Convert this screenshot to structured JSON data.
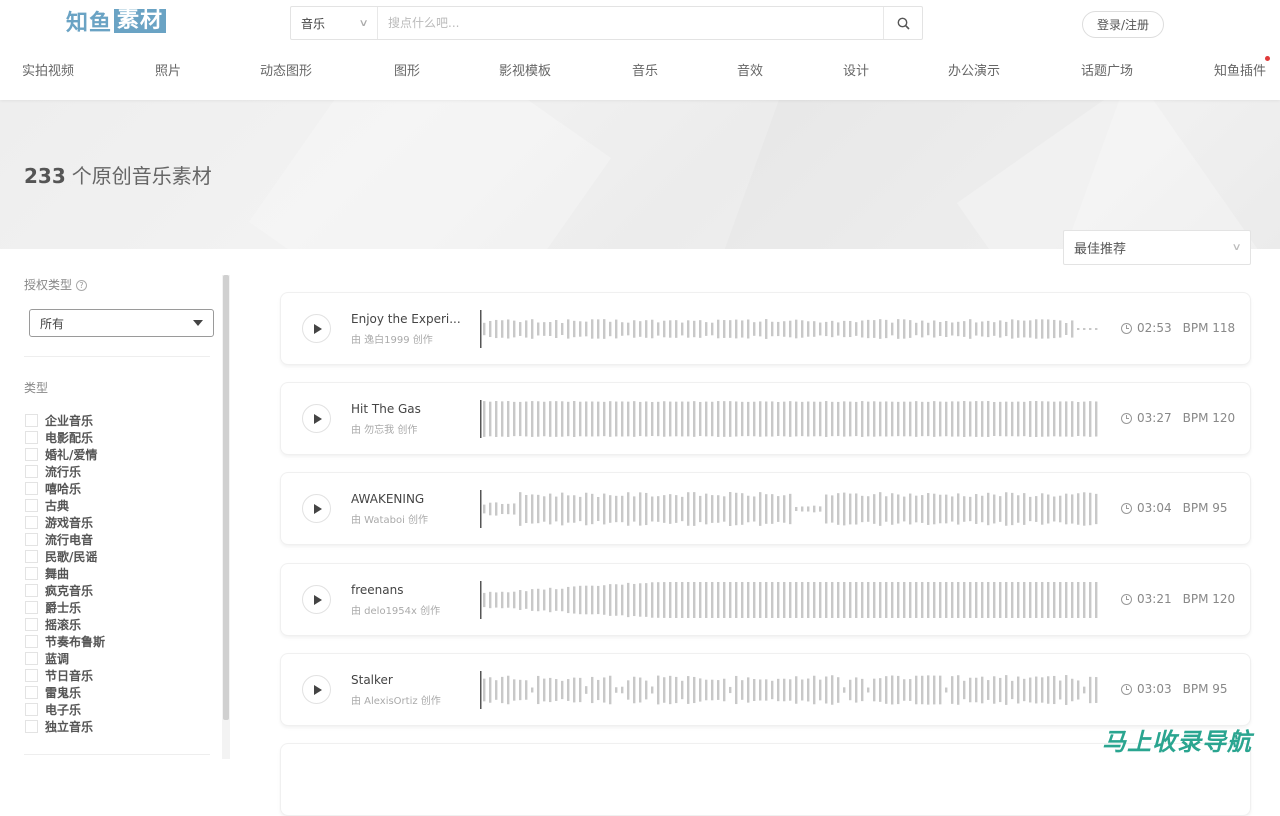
{
  "header": {
    "logo": {
      "part1": "知鱼",
      "part2": "素材"
    },
    "search": {
      "category": "音乐",
      "placeholder": "搜点什么吧..."
    },
    "login_label": "登录/注册",
    "nav": [
      {
        "label": "实拍视频"
      },
      {
        "label": "照片"
      },
      {
        "label": "动态图形"
      },
      {
        "label": "图形"
      },
      {
        "label": "影视模板"
      },
      {
        "label": "音乐"
      },
      {
        "label": "音效"
      },
      {
        "label": "设计"
      },
      {
        "label": "办公演示"
      },
      {
        "label": "话题广场"
      },
      {
        "label": "知鱼插件",
        "badge": "red-dot"
      }
    ]
  },
  "banner": {
    "count": "233",
    "title": "个原创音乐素材"
  },
  "sort": {
    "selected": "最佳推荐"
  },
  "sidebar": {
    "license_label": "授权类型",
    "license_selected": "所有",
    "genre_label": "类型",
    "genres": [
      "企业音乐",
      "电影配乐",
      "婚礼/爱情",
      "流行乐",
      "嘻哈乐",
      "古典",
      "游戏音乐",
      "流行电音",
      "民歌/民谣",
      "舞曲",
      "疯克音乐",
      "爵士乐",
      "摇滚乐",
      "节奏布鲁斯",
      "蓝调",
      "节日音乐",
      "雷鬼乐",
      "电子乐",
      "独立音乐"
    ]
  },
  "tracks": [
    {
      "title": "Enjoy the Experi...",
      "author": "由 逸白1999 创作",
      "duration": "02:53",
      "bpm": "BPM 118",
      "wave_style": "even-tail"
    },
    {
      "title": "Hit The Gas",
      "author": "由 勿忘我 创作",
      "duration": "03:27",
      "bpm": "BPM 120",
      "wave_style": "full"
    },
    {
      "title": "AWAKENING",
      "author": "由 Wataboi 创作",
      "duration": "03:04",
      "bpm": "BPM 95",
      "wave_style": "dip"
    },
    {
      "title": "freenans",
      "author": "由 delo1954x 创作",
      "duration": "03:21",
      "bpm": "BPM 120",
      "wave_style": "ramp"
    },
    {
      "title": "Stalker",
      "author": "由 AlexisOrtiz 创作",
      "duration": "03:03",
      "bpm": "BPM 95",
      "wave_style": "varied"
    }
  ],
  "watermark": "马上收录导航",
  "colors": {
    "brand": "#6aa3c4",
    "wave": "#c8c8c8",
    "playhead": "#555555",
    "watermark": "#2aa590",
    "badge": "#e03a3a"
  }
}
